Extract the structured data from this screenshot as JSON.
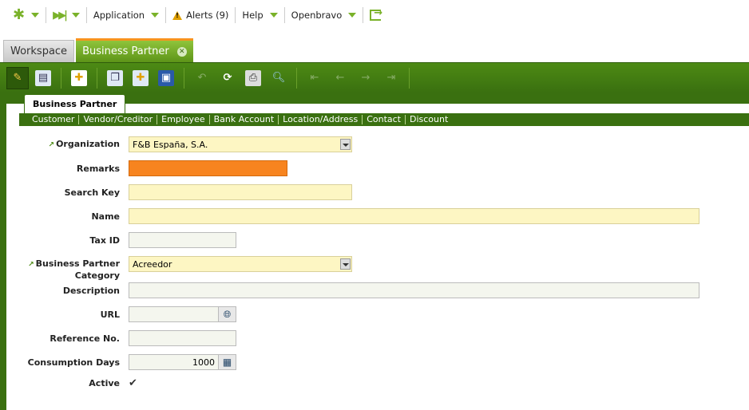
{
  "nav": {
    "application": "Application",
    "alerts": "Alerts (9)",
    "help": "Help",
    "user": "Openbravo"
  },
  "tabs": {
    "workspace": "Workspace",
    "business_partner": "Business Partner"
  },
  "window": {
    "tab_title": "Business Partner",
    "subtabs": [
      "Customer",
      "Vendor/Creditor",
      "Employee",
      "Bank Account",
      "Location/Address",
      "Contact",
      "Discount"
    ]
  },
  "form": {
    "organization": {
      "label": "Organization",
      "value": "F&B España, S.A."
    },
    "remarks": {
      "label": "Remarks",
      "value": ""
    },
    "search_key": {
      "label": "Search Key",
      "value": ""
    },
    "name": {
      "label": "Name",
      "value": ""
    },
    "tax_id": {
      "label": "Tax ID",
      "value": ""
    },
    "category": {
      "label_line1": "Business Partner",
      "label_line2": "Category",
      "value": "Acreedor"
    },
    "description": {
      "label": "Description",
      "value": ""
    },
    "url": {
      "label": "URL",
      "value": ""
    },
    "reference_no": {
      "label": "Reference No.",
      "value": ""
    },
    "consumption_days": {
      "label": "Consumption Days",
      "value": "1000"
    },
    "active": {
      "label": "Active",
      "checked": true
    }
  },
  "colors": {
    "brand_green": "#3a7010",
    "accent_orange": "#f7931e",
    "required_yellow": "#fdf6c3"
  }
}
